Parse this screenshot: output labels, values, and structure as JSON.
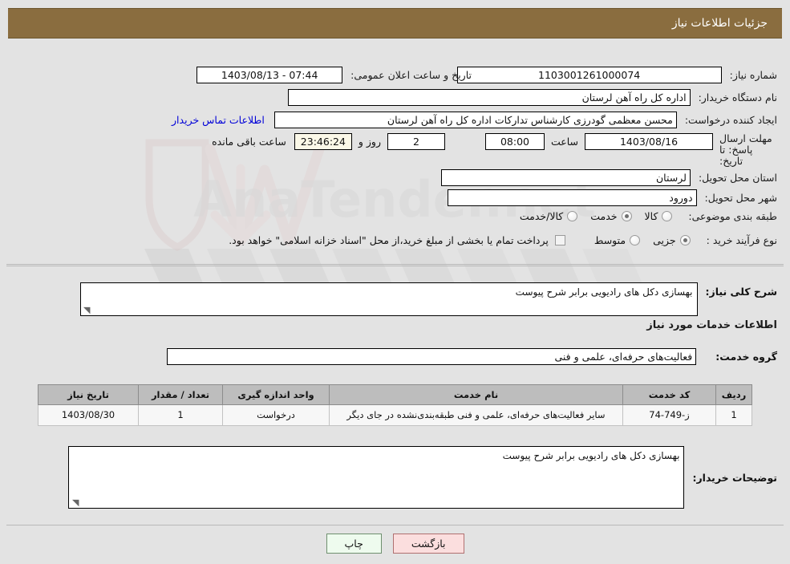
{
  "header": {
    "title": "جزئیات اطلاعات نیاز"
  },
  "form": {
    "need_number_label": "شماره نیاز:",
    "need_number_value": "1103001261000074",
    "announce_label": "تاریخ و ساعت اعلان عمومی:",
    "announce_value": "07:44 - 1403/08/13",
    "buyer_org_label": "نام دستگاه خریدار:",
    "buyer_org_value": "اداره کل راه آهن لرستان",
    "requester_label": "ایجاد کننده درخواست:",
    "requester_value": "محسن معظمی گودرزی کارشناس تدارکات اداره کل راه آهن لرستان",
    "contact_link": "اطلاعات تماس خریدار",
    "deadline_label": "مهلت ارسال پاسخ: تا تاریخ:",
    "deadline_date": "1403/08/16",
    "hour_label": "ساعت",
    "deadline_time": "08:00",
    "days_value": "2",
    "days_label": "روز و",
    "countdown_value": "23:46:24",
    "remaining_label": "ساعت باقی مانده",
    "province_label": "استان محل تحویل:",
    "province_value": "لرستان",
    "city_label": "شهر محل تحویل:",
    "city_value": "دورود",
    "category_label": "طبقه بندی موضوعی:",
    "category_options": [
      {
        "label": "کالا",
        "selected": false
      },
      {
        "label": "خدمت",
        "selected": true
      },
      {
        "label": "کالا/خدمت",
        "selected": false
      }
    ],
    "process_label": "نوع فرآیند خرید :",
    "process_options": [
      {
        "label": "جزیی",
        "selected": true
      },
      {
        "label": "متوسط",
        "selected": false
      }
    ],
    "treasury_checkbox_label": "پرداخت تمام یا بخشی از مبلغ خرید،از محل \"اسناد خزانه اسلامی\" خواهد بود.",
    "treasury_checked": false
  },
  "description": {
    "label": "شرح کلی نیاز:",
    "value": "بهسازی دکل های رادیویی برابر شرح پیوست"
  },
  "services": {
    "section_title": "اطلاعات خدمات مورد نیاز",
    "group_label": "گروه خدمت:",
    "group_value": "فعالیت‌های حرفه‌ای، علمی و فنی",
    "columns": [
      "ردیف",
      "کد خدمت",
      "نام خدمت",
      "واحد اندازه گیری",
      "تعداد / مقدار",
      "تاریخ نیاز"
    ],
    "rows": [
      {
        "index": "1",
        "code": "ز-749-74",
        "name": "سایر فعالیت‌های حرفه‌ای، علمی و فنی طبقه‌بندی‌نشده در جای دیگر",
        "unit": "درخواست",
        "quantity": "1",
        "need_date": "1403/08/30"
      }
    ]
  },
  "buyer_notes": {
    "label": "توضیحات خریدار:",
    "value": "بهسازی دکل های رادیویی برابر شرح پیوست"
  },
  "footer": {
    "print_label": "چاپ",
    "back_label": "بازگشت"
  },
  "watermark": {
    "text": "AnaTender.net"
  }
}
